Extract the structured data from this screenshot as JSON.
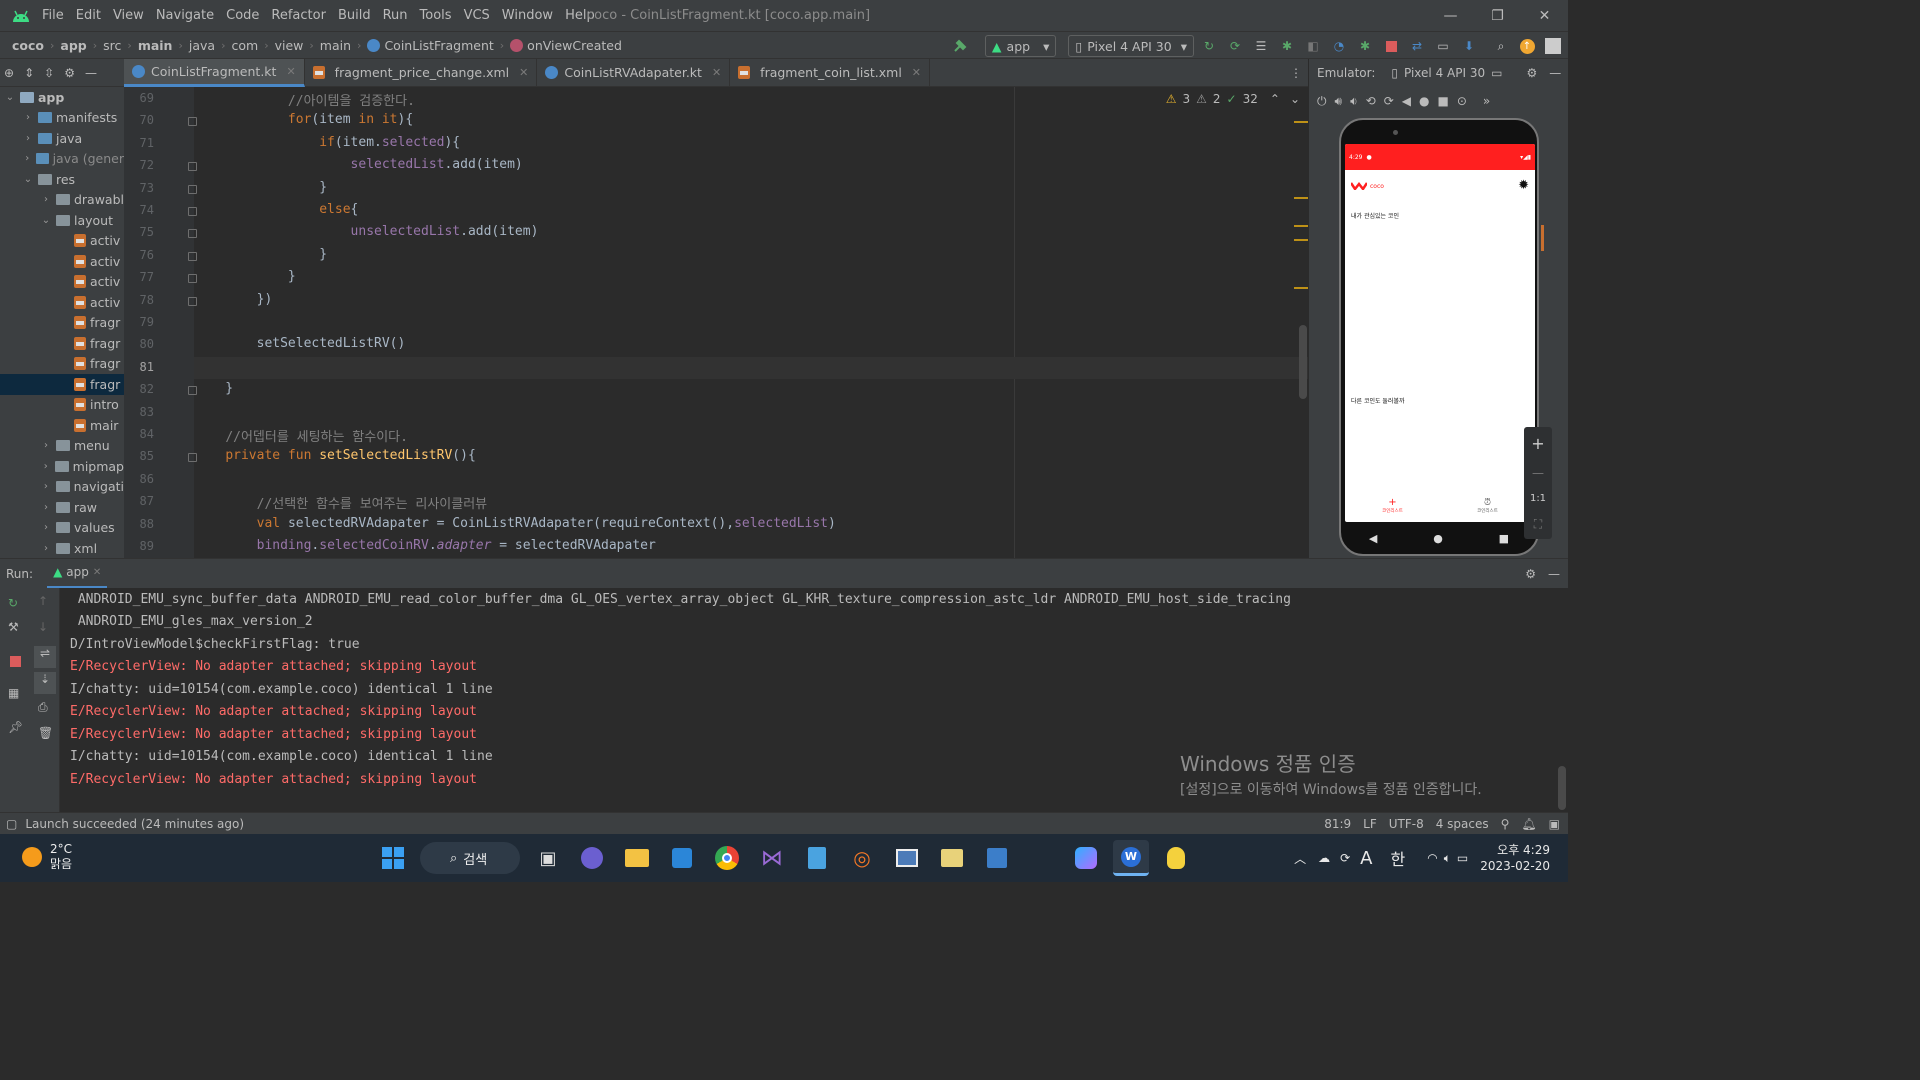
{
  "app": {
    "title": "coco - CoinListFragment.kt [coco.app.main]",
    "menu": [
      "File",
      "Edit",
      "View",
      "Navigate",
      "Code",
      "Refactor",
      "Build",
      "Run",
      "Tools",
      "VCS",
      "Window",
      "Help"
    ],
    "window_buttons": {
      "minimize": "—",
      "restore": "❐",
      "close": "✕"
    }
  },
  "breadcrumb": [
    "coco",
    "app",
    "src",
    "main",
    "java",
    "com",
    "view",
    "main",
    "CoinListFragment",
    "onViewCreated"
  ],
  "toolbar": {
    "run_config": "app",
    "device": "Pixel 4 API 30"
  },
  "tabs": [
    {
      "label": "CoinListFragment.kt",
      "type": "kt",
      "active": true
    },
    {
      "label": "fragment_price_change.xml",
      "type": "xml",
      "active": false
    },
    {
      "label": "CoinListRVAdapater.kt",
      "type": "kt",
      "active": false
    },
    {
      "label": "fragment_coin_list.xml",
      "type": "xml",
      "active": false
    }
  ],
  "tree": [
    {
      "label": "app",
      "level": 0,
      "chev": "v",
      "icon": "module",
      "bold": true
    },
    {
      "label": "manifests",
      "level": 1,
      "chev": ">",
      "icon": "folder-blue"
    },
    {
      "label": "java",
      "level": 1,
      "chev": ">",
      "icon": "folder-blue"
    },
    {
      "label": "java (gener",
      "level": 1,
      "chev": ">",
      "icon": "folder-blue",
      "dim": true
    },
    {
      "label": "res",
      "level": 1,
      "chev": "v",
      "icon": "folder"
    },
    {
      "label": "drawabl",
      "level": 2,
      "chev": ">",
      "icon": "folder"
    },
    {
      "label": "layout",
      "level": 2,
      "chev": "v",
      "icon": "folder"
    },
    {
      "label": "activ",
      "level": 3,
      "chev": "",
      "icon": "xml"
    },
    {
      "label": "activ",
      "level": 3,
      "chev": "",
      "icon": "xml"
    },
    {
      "label": "activ",
      "level": 3,
      "chev": "",
      "icon": "xml"
    },
    {
      "label": "activ",
      "level": 3,
      "chev": "",
      "icon": "xml"
    },
    {
      "label": "fragr",
      "level": 3,
      "chev": "",
      "icon": "xml"
    },
    {
      "label": "fragr",
      "level": 3,
      "chev": "",
      "icon": "xml"
    },
    {
      "label": "fragr",
      "level": 3,
      "chev": "",
      "icon": "xml"
    },
    {
      "label": "fragr",
      "level": 3,
      "chev": "",
      "icon": "xml",
      "selected": true
    },
    {
      "label": "intro",
      "level": 3,
      "chev": "",
      "icon": "xml"
    },
    {
      "label": "mair",
      "level": 3,
      "chev": "",
      "icon": "xml"
    },
    {
      "label": "menu",
      "level": 2,
      "chev": ">",
      "icon": "folder"
    },
    {
      "label": "mipmap",
      "level": 2,
      "chev": ">",
      "icon": "folder"
    },
    {
      "label": "navigati",
      "level": 2,
      "chev": ">",
      "icon": "folder"
    },
    {
      "label": "raw",
      "level": 2,
      "chev": ">",
      "icon": "folder"
    },
    {
      "label": "values",
      "level": 2,
      "chev": ">",
      "icon": "folder"
    },
    {
      "label": "xml",
      "level": 2,
      "chev": ">",
      "icon": "folder"
    }
  ],
  "editor": {
    "warnings": "3",
    "weak_warnings": "2",
    "typos": "32",
    "line_numbers": [
      "69",
      "70",
      "71",
      "72",
      "73",
      "74",
      "75",
      "76",
      "77",
      "78",
      "79",
      "80",
      "81",
      "82",
      "83",
      "84",
      "85",
      "86",
      "87",
      "88",
      "89"
    ],
    "current_line": "81",
    "lines": [
      [
        {
          "t": "            ",
          "c": ""
        },
        {
          "t": "//아이템을 검증한다.",
          "c": "cm"
        }
      ],
      [
        {
          "t": "            ",
          "c": ""
        },
        {
          "t": "for",
          "c": "kw"
        },
        {
          "t": "(item ",
          "c": ""
        },
        {
          "t": "in",
          "c": "kw"
        },
        {
          "t": " ",
          "c": ""
        },
        {
          "t": "it",
          "c": "kw"
        },
        {
          "t": "){",
          "c": ""
        }
      ],
      [
        {
          "t": "                ",
          "c": ""
        },
        {
          "t": "if",
          "c": "kw"
        },
        {
          "t": "(item.",
          "c": ""
        },
        {
          "t": "selected",
          "c": "pr"
        },
        {
          "t": "){",
          "c": ""
        }
      ],
      [
        {
          "t": "                    ",
          "c": ""
        },
        {
          "t": "selectedList",
          "c": "pr"
        },
        {
          "t": ".add(item)",
          "c": ""
        }
      ],
      [
        {
          "t": "                }",
          "c": ""
        }
      ],
      [
        {
          "t": "                ",
          "c": ""
        },
        {
          "t": "else",
          "c": "kw"
        },
        {
          "t": "{",
          "c": ""
        }
      ],
      [
        {
          "t": "                    ",
          "c": ""
        },
        {
          "t": "unselectedList",
          "c": "pr"
        },
        {
          "t": ".add(item)",
          "c": ""
        }
      ],
      [
        {
          "t": "                }",
          "c": ""
        }
      ],
      [
        {
          "t": "            }",
          "c": ""
        }
      ],
      [
        {
          "t": "        })",
          "c": ""
        }
      ],
      [
        {
          "t": "",
          "c": ""
        }
      ],
      [
        {
          "t": "        setSelectedListRV()",
          "c": ""
        }
      ],
      [
        {
          "t": "",
          "c": ""
        }
      ],
      [
        {
          "t": "    }",
          "c": ""
        }
      ],
      [
        {
          "t": "",
          "c": ""
        }
      ],
      [
        {
          "t": "    ",
          "c": ""
        },
        {
          "t": "//어뎁터를 세팅하는 함수이다.",
          "c": "cm"
        }
      ],
      [
        {
          "t": "    ",
          "c": ""
        },
        {
          "t": "private fun ",
          "c": "kw"
        },
        {
          "t": "setSelectedListRV",
          "c": "fn"
        },
        {
          "t": "(){",
          "c": ""
        }
      ],
      [
        {
          "t": "",
          "c": ""
        }
      ],
      [
        {
          "t": "        ",
          "c": ""
        },
        {
          "t": "//선택한 함수를 보여주는 리사이클러뷰",
          "c": "cm"
        }
      ],
      [
        {
          "t": "        ",
          "c": ""
        },
        {
          "t": "val ",
          "c": "kw"
        },
        {
          "t": "selectedRVAdapater = CoinListRVAdapater(requireContext(),",
          "c": ""
        },
        {
          "t": "selectedList",
          "c": "pr"
        },
        {
          "t": ")",
          "c": ""
        }
      ],
      [
        {
          "t": "        ",
          "c": ""
        },
        {
          "t": "binding",
          "c": "pr"
        },
        {
          "t": ".",
          "c": ""
        },
        {
          "t": "selectedCoinRV",
          "c": "pr"
        },
        {
          "t": ".",
          "c": ""
        },
        {
          "t": "adapter",
          "c": "it"
        },
        {
          "t": " = selectedRVAdapater",
          "c": ""
        }
      ]
    ]
  },
  "emulator": {
    "label": "Emulator:",
    "device": "Pixel 4 API 30",
    "phone": {
      "status_time": "4:29",
      "app_name": "coco",
      "section1": "내가 관심있는 코인",
      "section2": "다른 코인도 둘러볼까",
      "nav_left": "코인리스트",
      "nav_right": "코인리스트"
    },
    "zoom_label": "1:1"
  },
  "run": {
    "label": "Run:",
    "config": "app",
    "lines": [
      {
        "text": " ANDROID_EMU_sync_buffer_data ANDROID_EMU_read_color_buffer_dma GL_OES_vertex_array_object GL_KHR_texture_compression_astc_ldr ANDROID_EMU_host_side_tracing",
        "level": "n"
      },
      {
        "text": " ANDROID_EMU_gles_max_version_2",
        "level": "n"
      },
      {
        "text": "D/IntroViewModel$checkFirstFlag: true",
        "level": "n"
      },
      {
        "text": "E/RecyclerView: No adapter attached; skipping layout",
        "level": "e"
      },
      {
        "text": "I/chatty: uid=10154(com.example.coco) identical 1 line",
        "level": "n"
      },
      {
        "text": "E/RecyclerView: No adapter attached; skipping layout",
        "level": "e"
      },
      {
        "text": "E/RecyclerView: No adapter attached; skipping layout",
        "level": "e"
      },
      {
        "text": "I/chatty: uid=10154(com.example.coco) identical 1 line",
        "level": "n"
      },
      {
        "text": "E/RecyclerView: No adapter attached; skipping layout",
        "level": "e"
      }
    ]
  },
  "watermark": {
    "title": "Windows 정품 인증",
    "subtitle": "[설정]으로 이동하여 Windows를 정품 인증합니다."
  },
  "status": {
    "message": "Launch succeeded (24 minutes ago)",
    "position": "81:9",
    "line_sep": "LF",
    "encoding": "UTF-8",
    "indent": "4 spaces"
  },
  "taskbar": {
    "weather_temp": "2°C",
    "weather_desc": "맑음",
    "search": "검색",
    "ime": "A",
    "lang": "한",
    "time": "오후 4:29",
    "date": "2023-02-20"
  },
  "colors": {
    "accent": "#4a88c7",
    "error": "#ff6b68",
    "phone_red": "#ff1f1f"
  }
}
